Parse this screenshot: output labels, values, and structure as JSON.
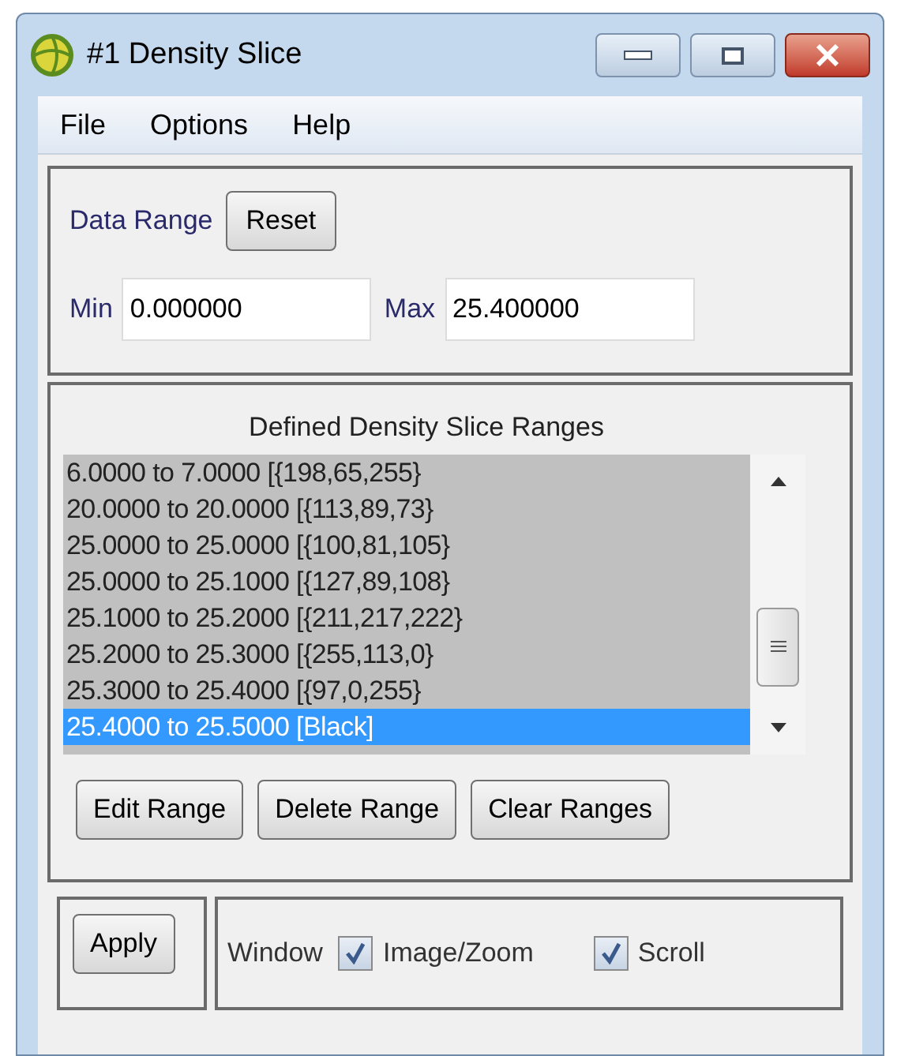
{
  "window": {
    "title": "#1 Density Slice"
  },
  "menu": [
    "File",
    "Options",
    "Help"
  ],
  "data_range": {
    "label": "Data Range",
    "reset_button": "Reset",
    "min_label": "Min",
    "min_value": "0.000000",
    "max_label": "Max",
    "max_value": "25.400000"
  },
  "ranges": {
    "title": "Defined Density Slice Ranges",
    "items": [
      {
        "label": "6.0000 to 7.0000 [{198,65,255}",
        "selected": false
      },
      {
        "label": "20.0000 to 20.0000 [{113,89,73}",
        "selected": false
      },
      {
        "label": "25.0000 to 25.0000 [{100,81,105}",
        "selected": false
      },
      {
        "label": "25.0000 to 25.1000 [{127,89,108}",
        "selected": false
      },
      {
        "label": "25.1000 to 25.2000 [{211,217,222}",
        "selected": false
      },
      {
        "label": "25.2000 to 25.3000 [{255,113,0}",
        "selected": false
      },
      {
        "label": "25.3000 to 25.4000 [{97,0,255}",
        "selected": false
      },
      {
        "label": "25.4000 to 25.5000 [Black]",
        "selected": true
      }
    ],
    "buttons": [
      "Edit Range",
      "Delete Range",
      "Clear Ranges"
    ]
  },
  "apply_button": "Apply",
  "window_options": {
    "label": "Window",
    "checkboxes": [
      {
        "label": "Image/Zoom",
        "checked": true
      },
      {
        "label": "Scroll",
        "checked": true
      }
    ]
  }
}
